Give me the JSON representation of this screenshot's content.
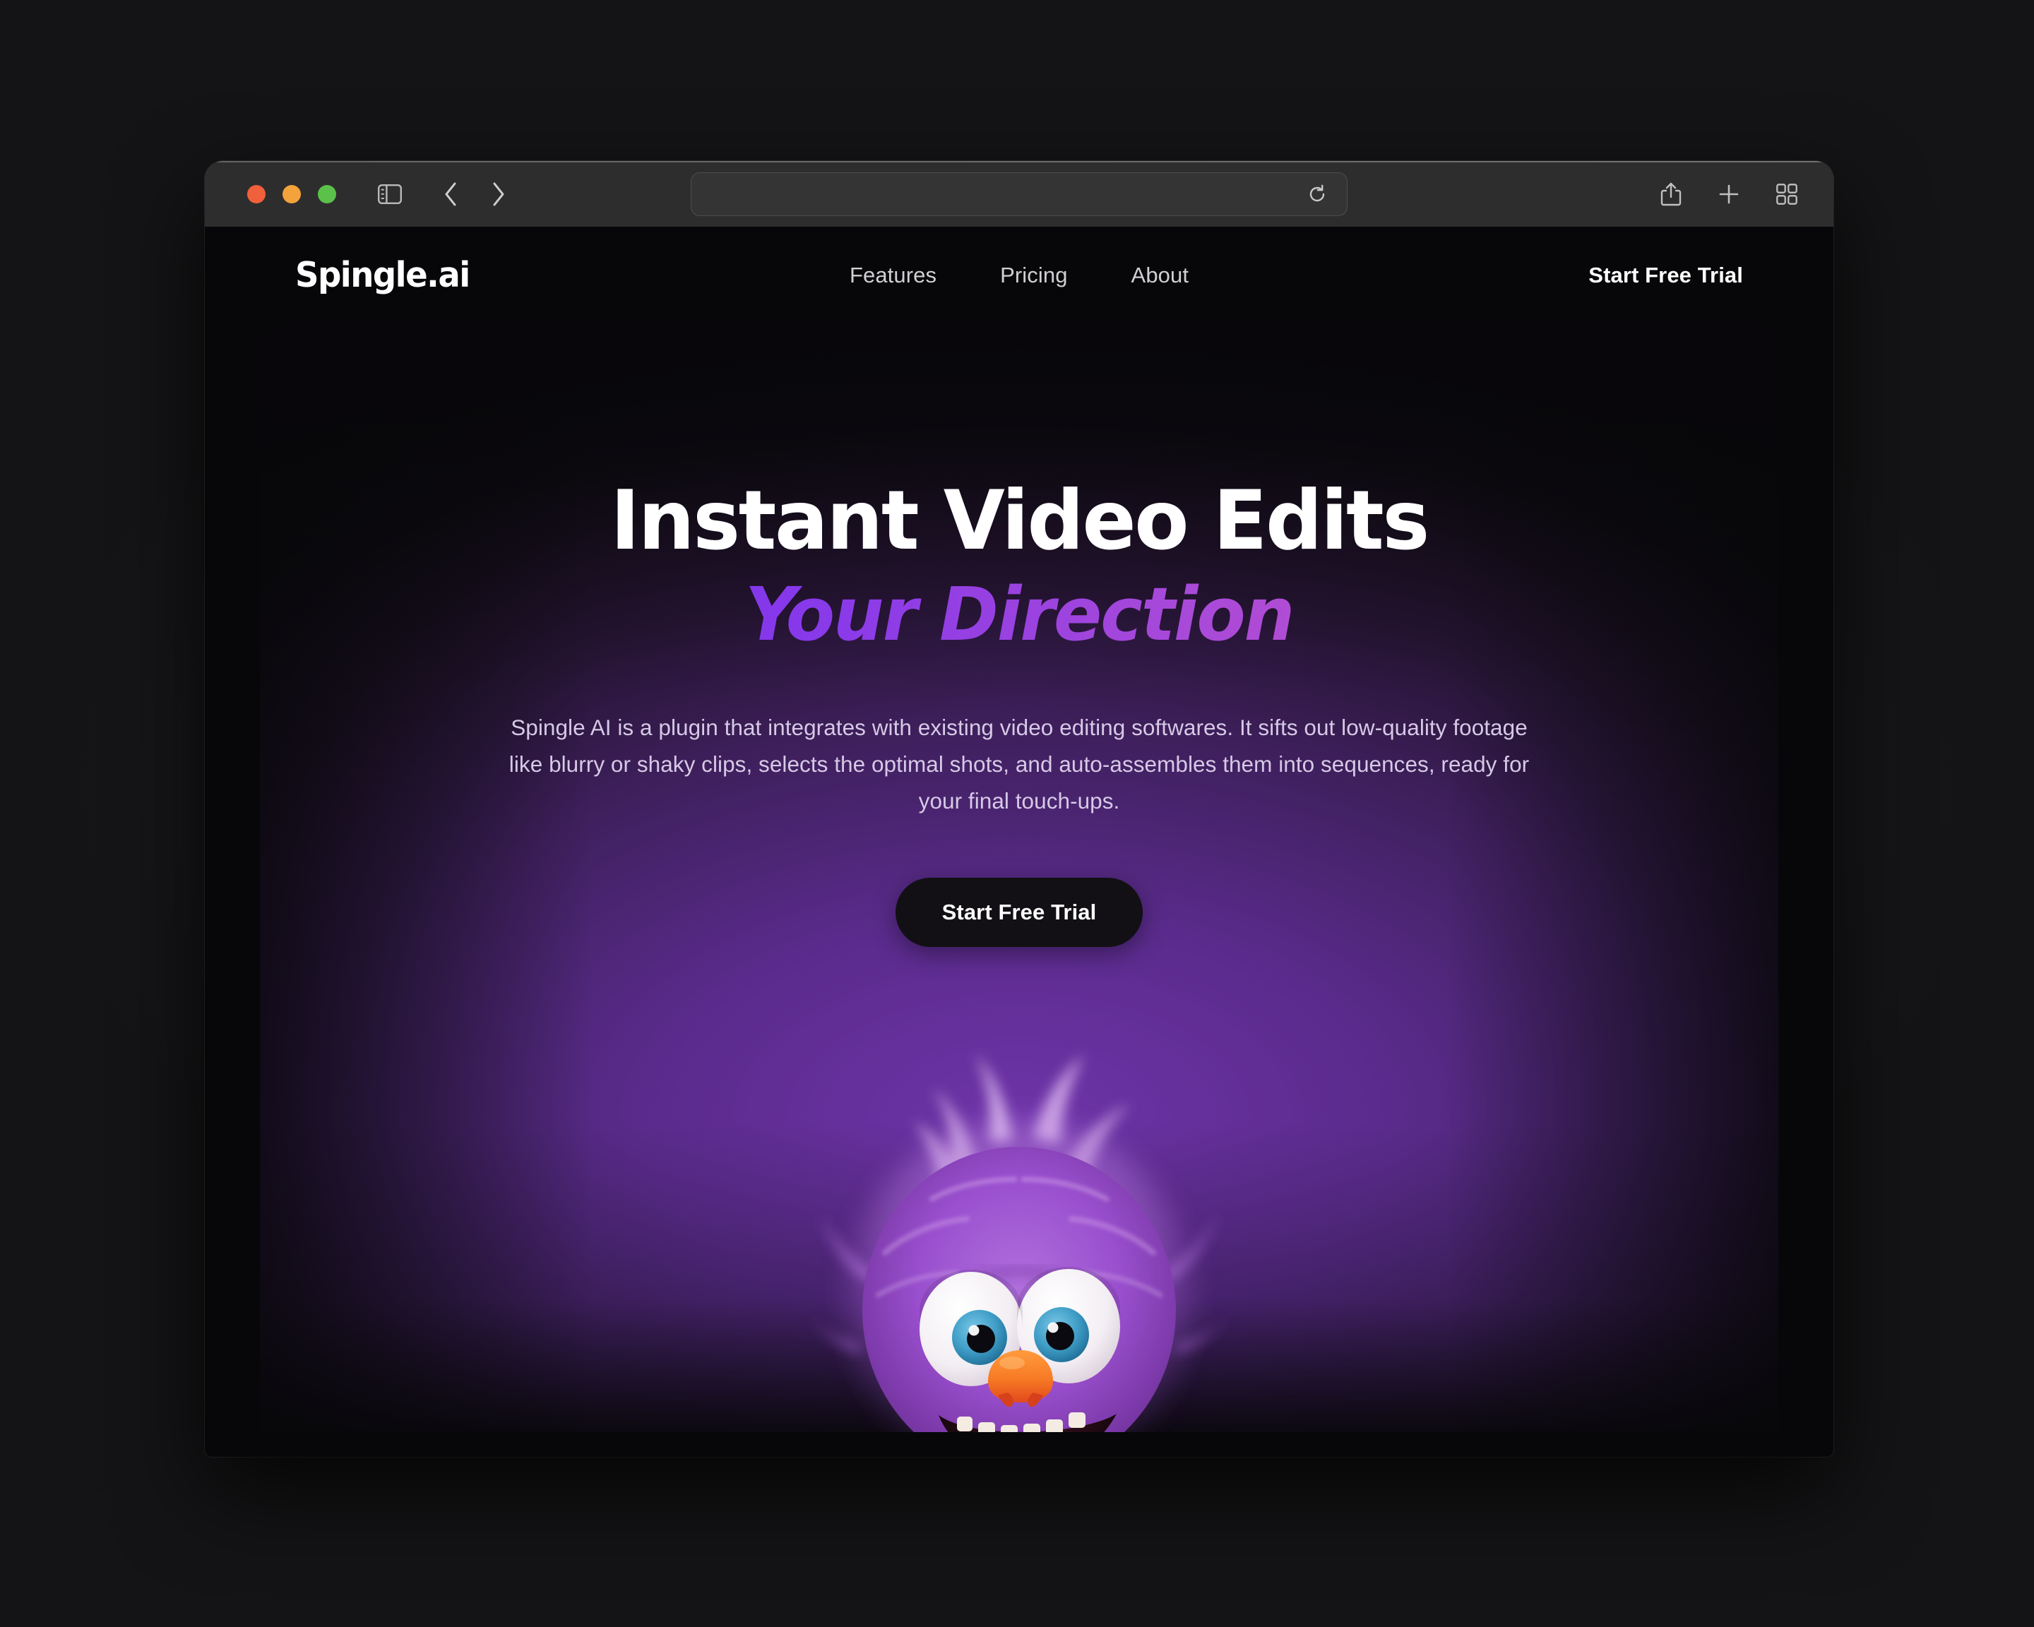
{
  "browser": {
    "traffic_lights": [
      {
        "name": "close",
        "color": "#f0603a"
      },
      {
        "name": "minimize",
        "color": "#f3a23c"
      },
      {
        "name": "zoom",
        "color": "#5bc14b"
      }
    ],
    "sidebar_icon": "sidebar-icon",
    "back_icon": "chevron-left-icon",
    "forward_icon": "chevron-right-icon",
    "address": {
      "value": "",
      "placeholder": ""
    },
    "reload_icon": "reload-icon",
    "share_icon": "share-icon",
    "new_tab_icon": "plus-icon",
    "tab_overview_icon": "tab-overview-icon"
  },
  "site": {
    "logo": "Spingle.ai",
    "nav": [
      {
        "label": "Features"
      },
      {
        "label": "Pricing"
      },
      {
        "label": "About"
      }
    ],
    "header_cta": "Start Free Trial"
  },
  "hero": {
    "headline": "Instant Video Edits",
    "subheadline": "Your Direction",
    "description": "Spingle AI is a plugin that integrates with existing video editing softwares. It sifts out low-quality footage like blurry or shaky clips, selects the optimal shots, and auto-assembles them into sequences, ready for your final touch-ups.",
    "cta": "Start Free Trial",
    "mascot": "purple-furry-monster"
  },
  "colors": {
    "page_background": "#141416",
    "window_chrome": "#2e2d2d",
    "site_background": "#070709",
    "hero_purple": "#5a2b8c",
    "gradient_start": "#6528f7",
    "gradient_end": "#d053c4",
    "button_background": "#121014",
    "body_text": "#d6c9e6"
  }
}
